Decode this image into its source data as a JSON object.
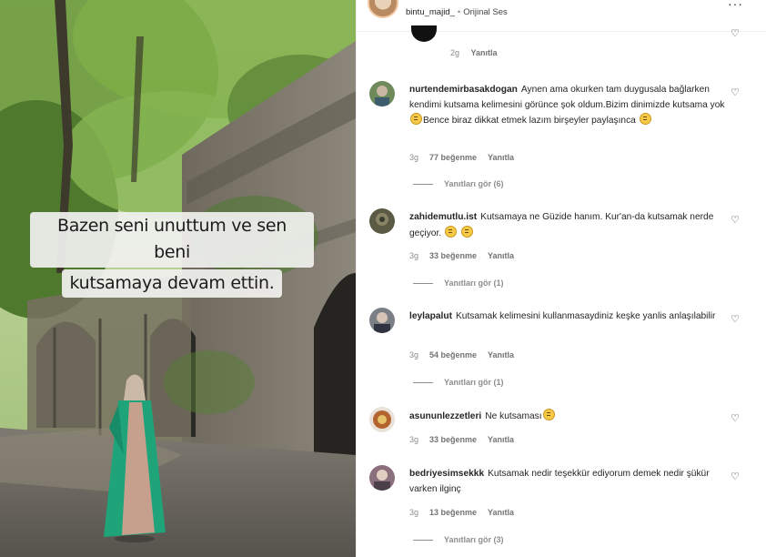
{
  "post": {
    "caption_lines": [
      "Bazen seni unuttum ve sen beni",
      "kutsamaya devam ettin."
    ],
    "header": {
      "username": "bintu_majid_",
      "audio": "Orijinal Ses",
      "more": "···"
    }
  },
  "previous_comment": {
    "time": "2g",
    "reply": "Yanıtla"
  },
  "comments": [
    {
      "username": "nurtendemirbasakdogan",
      "text_parts": [
        "Aynen ama okurken tam duygusala bağlarken kendimi kutsama kelimesini görünce şok oldum.Bizim dinimizde kutsama yok",
        "Bence biraz dikkat etmek lazım birşeyler paylaşınca",
        ""
      ],
      "time": "3g",
      "likes": "77 beğenme",
      "reply": "Yanıtla",
      "replies": "Yanıtları gör (6)",
      "avatar_color": "#6f8a5a"
    },
    {
      "username": "zahidemutlu.ist",
      "text_parts": [
        "Kutsamaya ne Güzide hanım. Kur'an-da kutsamak nerde geçiyor.",
        " ",
        ""
      ],
      "time": "3g",
      "likes": "33 beğenme",
      "reply": "Yanıtla",
      "replies": "Yanıtları gör (1)",
      "avatar_color": "#5b5a45"
    },
    {
      "username": "leylapalut",
      "text_parts": [
        "Kutsamak kelimesini kullanmasaydiniz keşke yanlis anlaşılabilir"
      ],
      "time": "3g",
      "likes": "54 beğenme",
      "reply": "Yanıtla",
      "replies": "Yanıtları gör (1)",
      "avatar_color": "#7a7f86"
    },
    {
      "username": "asununlezzetleri",
      "text_parts": [
        "Ne kutsaması",
        ""
      ],
      "time": "3g",
      "likes": "33 beğenme",
      "reply": "Yanıtla",
      "avatar_color": "#b4652f"
    },
    {
      "username": "bedriyesimsekkk",
      "text_parts": [
        "Kutsamak nedir teşekkür ediyorum demek nedir şükür varken ilginç"
      ],
      "time": "3g",
      "likes": "13 beğenme",
      "reply": "Yanıtla",
      "replies": "Yanıtları gör (3)",
      "avatar_color": "#8c6f7c"
    }
  ],
  "colors": {
    "text": "#262626",
    "meta": "#8e8e8e",
    "dress": "#1fa47a",
    "foliage": "#5f8a3a"
  }
}
